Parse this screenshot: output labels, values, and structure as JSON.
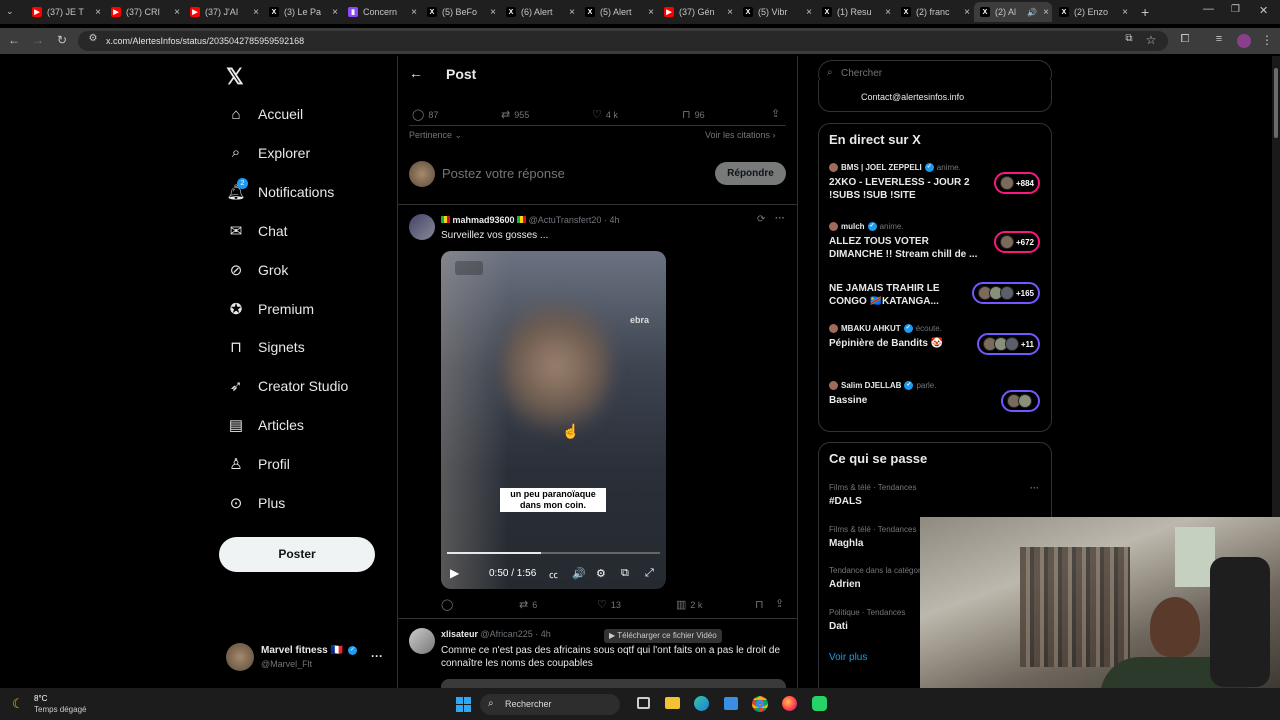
{
  "browser": {
    "tabs": [
      {
        "label": "(37) JE T",
        "icon": "youtube-icon"
      },
      {
        "label": "(37) CRI",
        "icon": "youtube-icon"
      },
      {
        "label": "(37) J'AI",
        "icon": "youtube-icon"
      },
      {
        "label": "(3) Le Pa",
        "icon": "x-icon"
      },
      {
        "label": "Concern",
        "icon": "twitch-icon"
      },
      {
        "label": "(5) BeFo",
        "icon": "x-icon"
      },
      {
        "label": "(6) Alert",
        "icon": "x-icon"
      },
      {
        "label": "(5) Alert",
        "icon": "x-icon"
      },
      {
        "label": "(37) Gén",
        "icon": "youtube-icon"
      },
      {
        "label": "(5) Vibr",
        "icon": "x-icon"
      },
      {
        "label": "(1) Resu",
        "icon": "x-icon"
      },
      {
        "label": "(2) franc",
        "icon": "x-icon"
      },
      {
        "label": "(2) Al",
        "icon": "x-icon"
      },
      {
        "label": "(2) Enzo",
        "icon": "x-icon"
      }
    ],
    "url": "x.com/AlertesInfos/status/2035042785959592168"
  },
  "nav": {
    "items": [
      {
        "label": "Accueil",
        "icon": "home-icon"
      },
      {
        "label": "Explorer",
        "icon": "search-icon"
      },
      {
        "label": "Notifications",
        "icon": "bell-icon",
        "badge": "2"
      },
      {
        "label": "Chat",
        "icon": "mail-icon"
      },
      {
        "label": "Grok",
        "icon": "grok-icon"
      },
      {
        "label": "Premium",
        "icon": "verified-icon"
      },
      {
        "label": "Signets",
        "icon": "bookmark-icon"
      },
      {
        "label": "Creator Studio",
        "icon": "rocket-icon"
      },
      {
        "label": "Articles",
        "icon": "article-icon"
      },
      {
        "label": "Profil",
        "icon": "person-icon"
      },
      {
        "label": "Plus",
        "icon": "more-circle-icon"
      }
    ],
    "post_label": "Poster",
    "account": {
      "name": "Marvel fitness 🇫🇷",
      "handle": "@Marvel_Flt"
    }
  },
  "post": {
    "header_title": "Post",
    "stats": {
      "replies": "87",
      "reposts": "955",
      "likes": "4 k",
      "bookmarks": "96"
    },
    "sort_label": "Pertinence",
    "quotes_label": "Voir les citations",
    "reply_placeholder": "Postez votre réponse",
    "reply_button": "Répondre"
  },
  "reply1": {
    "name": "mahmad93600",
    "handle": "@ActuTransfert20",
    "time": "· 4h",
    "text": "Surveillez vos gosses ...",
    "video_caption": "un peu paranoïaque dans mon coin.",
    "video_time": "0:50 / 1:56",
    "video_progress": 0.44,
    "watermark": "ebra",
    "stats": {
      "reposts": "6",
      "likes": "13",
      "views": "2 k"
    }
  },
  "reply2": {
    "name": "xlisateur",
    "handle": "@African225",
    "time": "· 4h",
    "text": "Comme ce n'est pas des africains sous oqtf qui l'ont faits on a pas le droit de connaître les noms des coupables",
    "download_label": "Télécharger ce fichier Vidéo"
  },
  "right": {
    "search_placeholder": "Chercher",
    "contact": "Contact@alertesinfos.info",
    "live_title": "En direct sur X",
    "live": [
      {
        "host": "BMS | JOEL ZEPPELI",
        "role": "anime.",
        "title": "2XKO - LEVERLESS - JOUR 2 !SUBS !SUB !SITE",
        "count": "+884",
        "ring": "#f91880"
      },
      {
        "host": "mulch",
        "role": "anime.",
        "title": "ALLEZ TOUS VOTER DIMANCHE !! Stream chill de ...",
        "count": "+672",
        "ring": "#f91880"
      },
      {
        "host": "",
        "role": "",
        "title": "NE JAMAIS TRAHIR LE CONGO 🇨🇩KATANGA...",
        "count": "+165",
        "ring": "#7856ff"
      },
      {
        "host": "MBAKU AHKUT",
        "role": "écoute.",
        "title": "Pépinière de Bandits 🤡",
        "count": "+11",
        "ring": "#7856ff"
      },
      {
        "host": "Salim DJELLAB",
        "role": "parle.",
        "title": "Bassine",
        "count": "",
        "ring": "#7856ff"
      }
    ],
    "trends_title": "Ce qui se passe",
    "trends": [
      {
        "meta": "Films & télé · Tendances",
        "name": "#DALS"
      },
      {
        "meta": "Films & télé · Tendances",
        "name": "Maghla"
      },
      {
        "meta": "Tendance dans la catégorie",
        "name": "Adrien"
      },
      {
        "meta": "Politique · Tendances",
        "name": "Dati"
      }
    ],
    "see_more": "Voir plus"
  },
  "taskbar": {
    "weather_temp": "8°C",
    "weather_text": "Temps dégagé",
    "search": "Rechercher"
  }
}
